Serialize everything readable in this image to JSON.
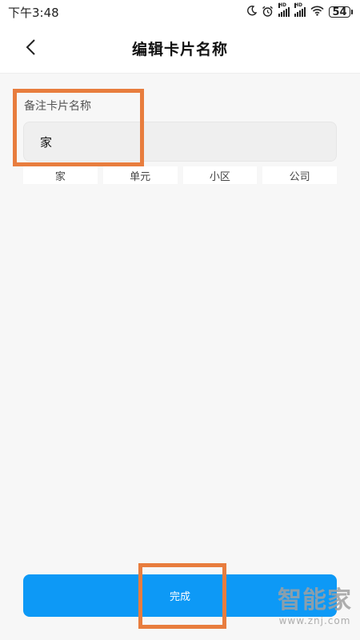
{
  "status_bar": {
    "time": "下午3:48",
    "icons": [
      "moon-icon",
      "alarm-icon",
      "signal-hd-icon",
      "signal-hd-icon",
      "wifi-icon",
      "battery-icon"
    ],
    "hd_label": "HD",
    "battery_level": "54"
  },
  "header": {
    "title": "编辑卡片名称",
    "back_icon": "chevron-left-icon"
  },
  "form": {
    "label": "备注卡片名称",
    "input_value": "家",
    "presets": [
      "家",
      "单元",
      "小区",
      "公司"
    ]
  },
  "actions": {
    "done_label": "完成"
  },
  "watermark": {
    "main": "智能家",
    "sub": "www.znj.com"
  },
  "colors": {
    "accent": "#0d99f6",
    "highlight": "#e87d3e",
    "background": "#f7f7f7"
  }
}
